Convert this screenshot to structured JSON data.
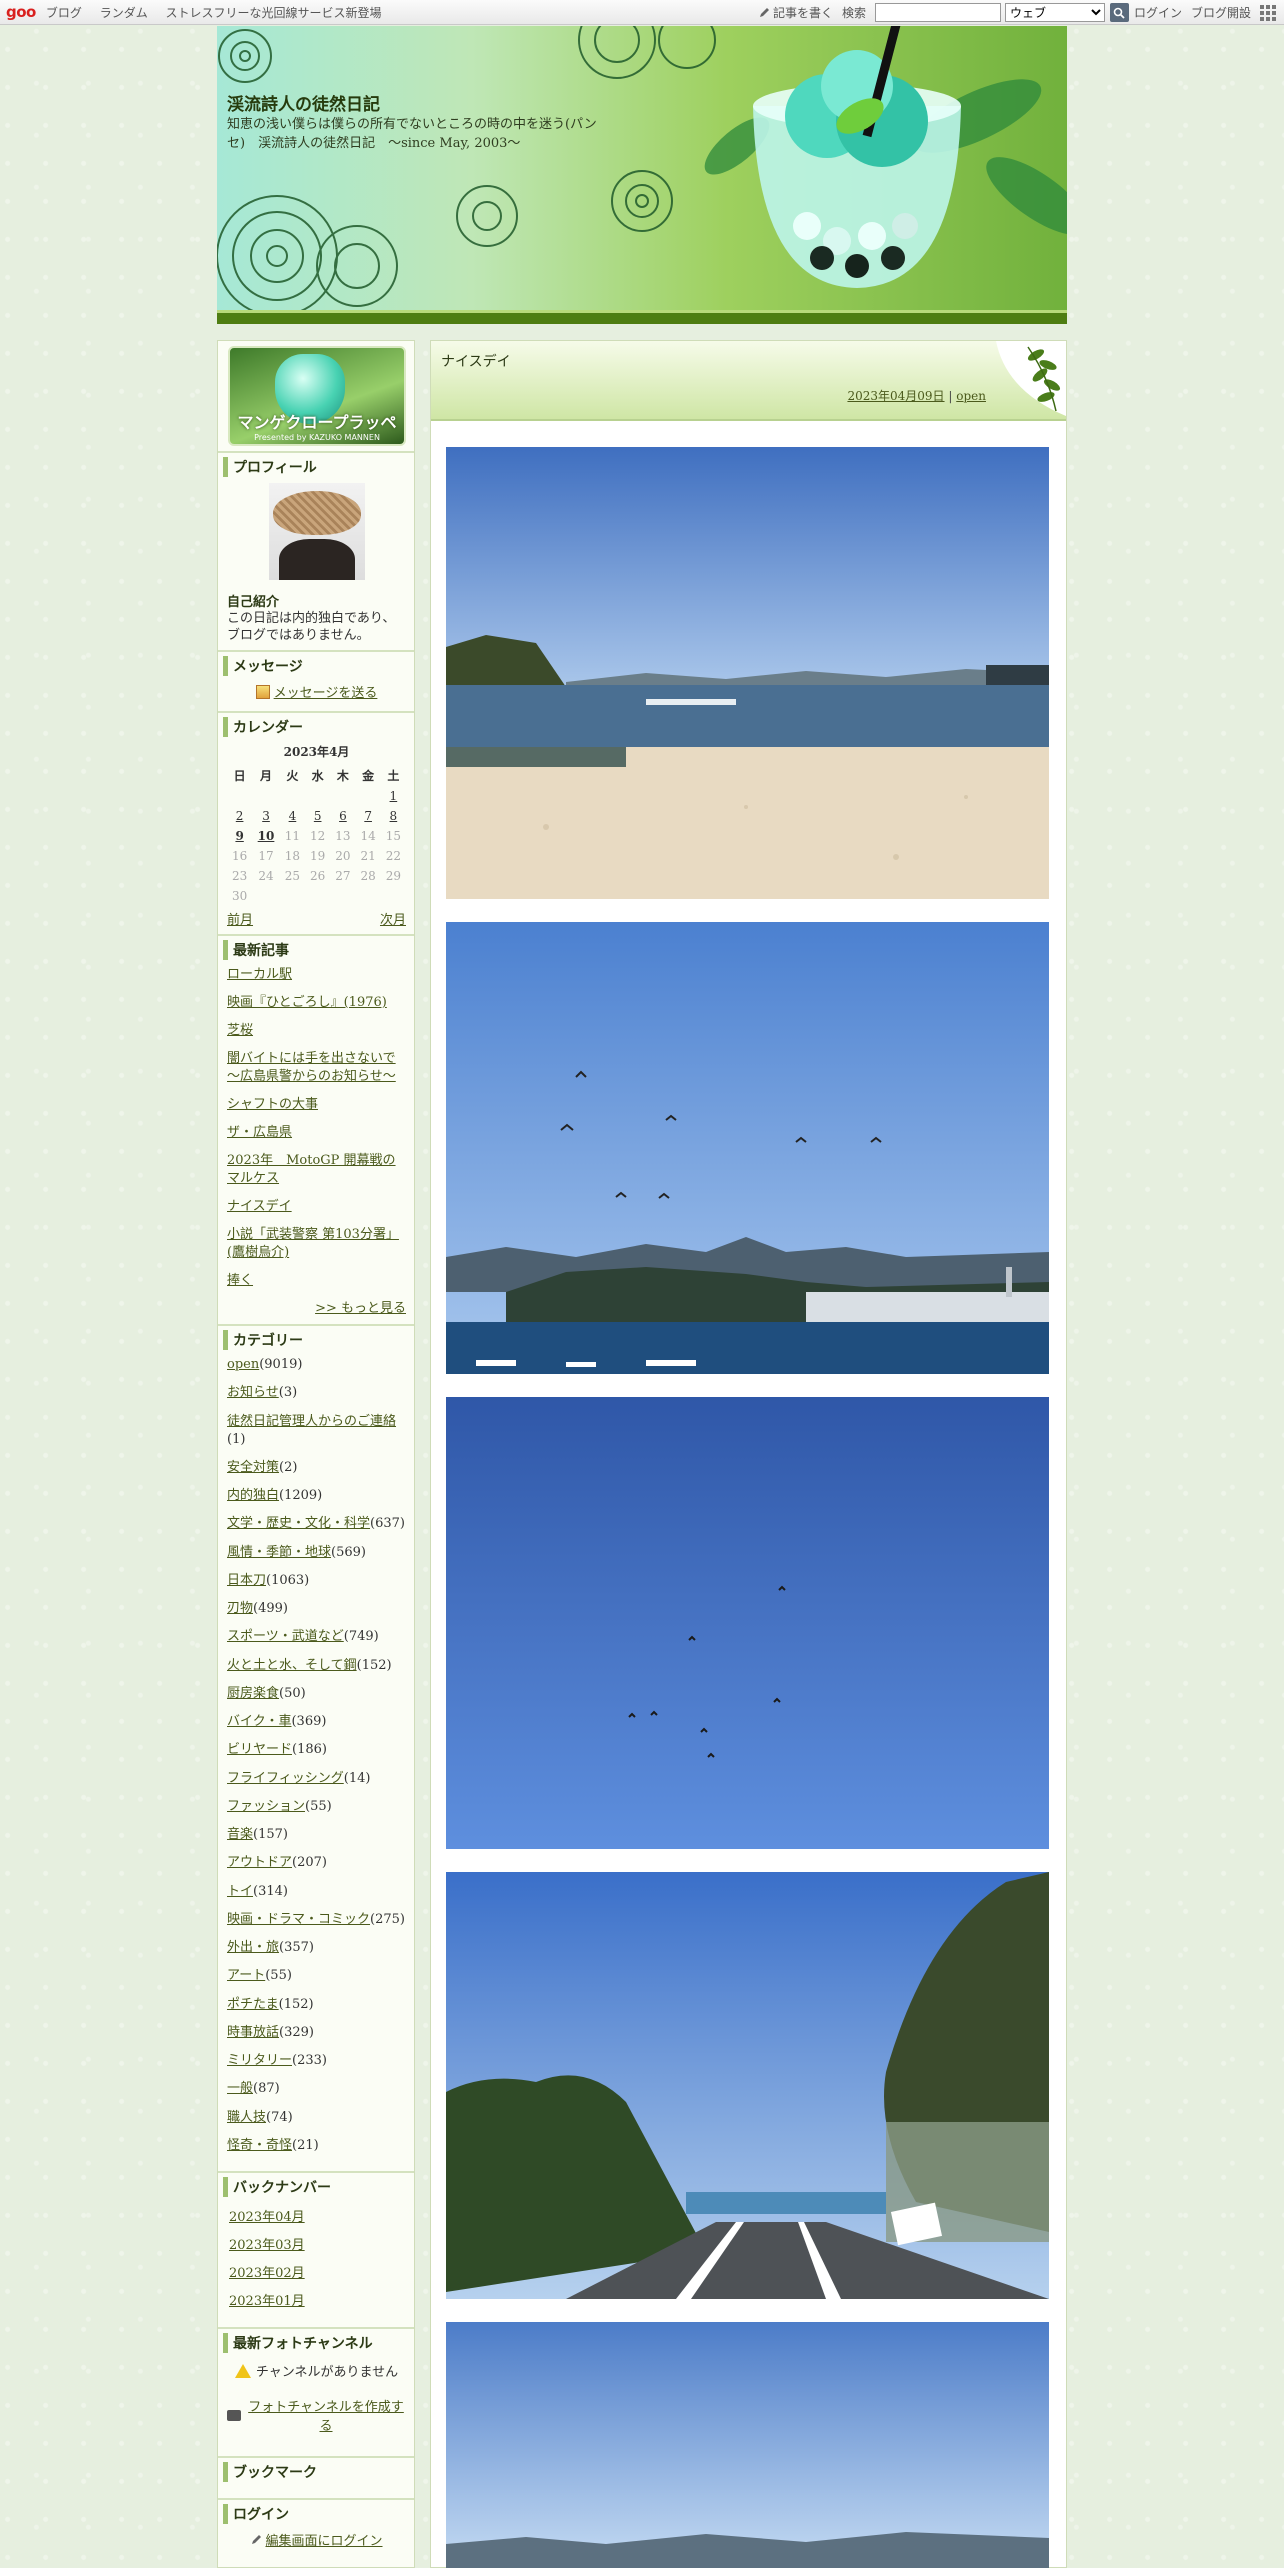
{
  "topbar": {
    "logo": "goo",
    "nav": [
      "ブログ",
      "ランダム",
      "ストレスフリーな光回線サービス新登場"
    ],
    "write": "記事を書く",
    "search_label": "検索",
    "search_value": "",
    "search_option": "ウェブ",
    "login": "ログイン",
    "open_blog": "ブログ開設"
  },
  "header": {
    "title": "渓流詩人の徒然日記",
    "subtitle": "知恵の浅い僕らは僕らの所有でないところの時の中を迷う(パンセ)　渓流詩人の徒然日記　～since May, 2003～"
  },
  "sidebar": {
    "logo_text": "マンゲクロープラッペ",
    "logo_sub": "Presented by KAZUKO MANNEN",
    "profile": {
      "title": "プロフィール",
      "self_label": "自己紹介",
      "self_text": "この日記は内的独白であり、ブログではありません。"
    },
    "message": {
      "title": "メッセージ",
      "link": "メッセージを送る"
    },
    "calendar": {
      "title": "カレンダー",
      "month": "2023年4月",
      "weekdays": [
        "日",
        "月",
        "火",
        "水",
        "木",
        "金",
        "土"
      ],
      "prev": "前月",
      "next": "次月"
    },
    "recent": {
      "title": "最新記事",
      "items": [
        "ローカル駅",
        "映画『ひとごろし』(1976)",
        "芝桜",
        "闇バイトには手を出さないで～広島県警からのお知らせ～",
        "シャフトの大事",
        "ザ・広島県",
        "2023年　MotoGP 開幕戦のマルケス",
        "ナイスデイ",
        "小説「武装警察 第103分署」(鷹樹烏介)",
        "捧く"
      ],
      "more": ">> もっと見る"
    },
    "categories": {
      "title": "カテゴリー",
      "items": [
        {
          "name": "open",
          "count": "(9019)"
        },
        {
          "name": "お知らせ",
          "count": "(3)"
        },
        {
          "name": "徒然日記管理人からのご連絡",
          "count": "(1)"
        },
        {
          "name": "安全対策",
          "count": "(2)"
        },
        {
          "name": "内的独白",
          "count": "(1209)"
        },
        {
          "name": "文学・歴史・文化・科学",
          "count": "(637)"
        },
        {
          "name": "風情・季節・地球",
          "count": "(569)"
        },
        {
          "name": "日本刀",
          "count": "(1063)"
        },
        {
          "name": "刃物",
          "count": "(499)"
        },
        {
          "name": "スポーツ・武道など",
          "count": "(749)"
        },
        {
          "name": "火と土と水、そして鋼",
          "count": "(152)"
        },
        {
          "name": "厨房楽食",
          "count": "(50)"
        },
        {
          "name": "バイク・車",
          "count": "(369)"
        },
        {
          "name": "ビリヤード",
          "count": "(186)"
        },
        {
          "name": "フライフィッシング",
          "count": "(14)"
        },
        {
          "name": "ファッション",
          "count": "(55)"
        },
        {
          "name": "音楽",
          "count": "(157)"
        },
        {
          "name": "アウトドア",
          "count": "(207)"
        },
        {
          "name": "トイ",
          "count": "(314)"
        },
        {
          "name": "映画・ドラマ・コミック",
          "count": "(275)"
        },
        {
          "name": "外出・旅",
          "count": "(357)"
        },
        {
          "name": "アート",
          "count": "(55)"
        },
        {
          "name": "ポチたま",
          "count": "(152)"
        },
        {
          "name": "時事放話",
          "count": "(329)"
        },
        {
          "name": "ミリタリー",
          "count": "(233)"
        },
        {
          "name": "一般",
          "count": "(87)"
        },
        {
          "name": "職人技",
          "count": "(74)"
        },
        {
          "name": "怪奇・奇怪",
          "count": "(21)"
        }
      ]
    },
    "backnumber": {
      "title": "バックナンバー",
      "items": [
        "2023年04月",
        "2023年03月",
        "2023年02月",
        "2023年01月"
      ]
    },
    "photo_channel": {
      "title": "最新フォトチャンネル",
      "none": "チャンネルがありません",
      "create": "フォトチャンネルを作成する"
    },
    "bookmark": {
      "title": "ブックマーク"
    },
    "login": {
      "title": "ログイン",
      "link": "編集画面にログイン"
    }
  },
  "post": {
    "title": "ナイスデイ",
    "date": "2023年04月09日",
    "separator": "|",
    "category": "open"
  },
  "colors": {
    "accent": "#4b5a1c",
    "header_dark": "#4e7d12",
    "sky": "#4b7fcc"
  }
}
